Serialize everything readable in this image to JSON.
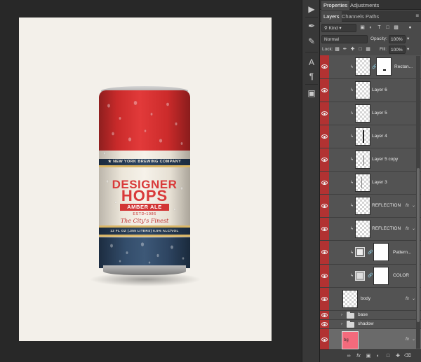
{
  "panel": {
    "top_tabs": [
      "Properties",
      "Adjustments"
    ],
    "tabs": [
      "Layers",
      "Channels",
      "Paths"
    ],
    "kind_label": "Kind",
    "blend_mode": "Normal",
    "opacity_label": "Opacity:",
    "opacity_value": "100%",
    "lock_label": "Lock:",
    "fill_label": "Fill:",
    "fill_value": "100%"
  },
  "layers": [
    {
      "name": "Rectan...",
      "kind": "mask"
    },
    {
      "name": "Layer 6",
      "kind": "pixel"
    },
    {
      "name": "Layer 5",
      "kind": "pixel"
    },
    {
      "name": "Layer 4",
      "kind": "pixel"
    },
    {
      "name": "Layer 5 copy",
      "kind": "pixel"
    },
    {
      "name": "Layer 3",
      "kind": "pixel"
    },
    {
      "name": "REFLECTION",
      "kind": "pixel",
      "fx": "fx"
    },
    {
      "name": "REFLECTION",
      "kind": "pixel",
      "fx": "fx"
    },
    {
      "name": "Pattern...",
      "kind": "adjust"
    },
    {
      "name": "COLOR",
      "kind": "adjust"
    },
    {
      "name": "body",
      "kind": "pixel",
      "fx": "fx"
    },
    {
      "name": "base",
      "kind": "group"
    },
    {
      "name": "shadow",
      "kind": "group"
    },
    {
      "name": "bg",
      "kind": "fill",
      "fx": "fx",
      "swatch": "#f46a7c"
    }
  ],
  "can": {
    "company": "★ NEW YORK BREWING COMPANY",
    "designer": "DESIGNER",
    "hops": "HOPS",
    "style": "AMBER ALE",
    "est": "ESTD•1986",
    "tagline": "The City's Finest",
    "volume": "12 FL OZ (.355 LITERS) 6.5% ALC/VOL"
  },
  "colors": {
    "layer_marker": "#b23232",
    "can_red": "#d93a3a",
    "can_blue": "#2d4766"
  }
}
